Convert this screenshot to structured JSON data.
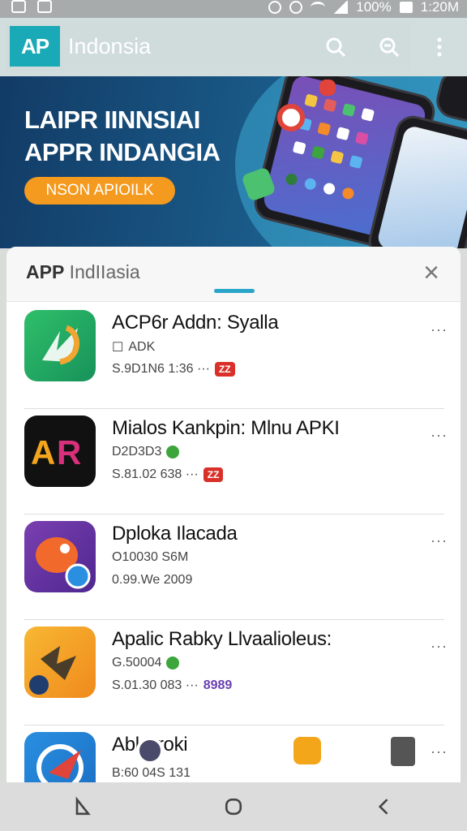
{
  "status_bar": {
    "battery": "100%",
    "time": "1:20M"
  },
  "app_bar": {
    "logo_text": "AP",
    "title": "Indonsia"
  },
  "banner": {
    "title_line1": "LAIPR IINNSIAI",
    "title_line2": "APPR INDANGIA",
    "cta_label": "NSON APIOILK"
  },
  "sheet": {
    "title_bold": "APP",
    "title_rest": " IndIIasia",
    "close_label": "×"
  },
  "apps": [
    {
      "name": "ACP6r Addn: Syalla",
      "meta1": "ADK",
      "meta2": "S.9D1N6 1:36 ···",
      "badge": "ZZ",
      "badge_type": "red",
      "menu": "···",
      "icon": "green-d-icon"
    },
    {
      "name": "Mialos Kankpin: Mlnu APKI",
      "meta1": "D2D3D3",
      "meta2": "S.81.02 638 ···",
      "badge": "ZZ",
      "badge_type": "red",
      "menu": "···",
      "icon": "ar-logo-icon"
    },
    {
      "name": "Dploka Ilacada",
      "meta1": "O10030 S6M",
      "meta2": "0.99.We 2009",
      "badge": "",
      "badge_type": "",
      "menu": "···",
      "icon": "orange-fish-icon"
    },
    {
      "name": "Apalic Rabky Llvaalioleus:",
      "meta1": "G.50004",
      "meta2": "S.01.30 083 ···",
      "badge": "8989",
      "badge_type": "purple",
      "menu": "···",
      "icon": "yellow-bird-icon"
    },
    {
      "name": "Abl Broki",
      "meta1": "",
      "meta2": "B:60 04S 131",
      "badge": "",
      "badge_type": "",
      "menu": "···",
      "icon": "blue-plane-icon"
    }
  ],
  "colors": {
    "accent": "#1aa9b6",
    "banner_bg": "#123b66",
    "cta": "#f49a1f",
    "badge_red": "#d9302a"
  }
}
